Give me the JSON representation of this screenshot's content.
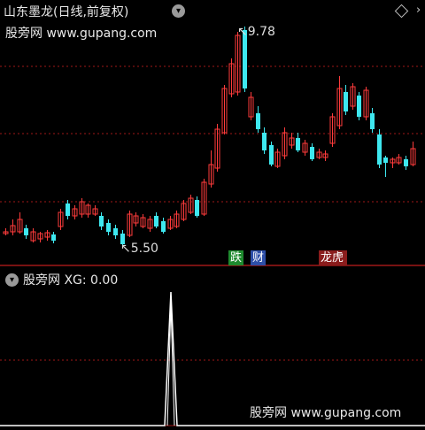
{
  "header": {
    "title": "山东墨龙(日线,前复权)",
    "dropdown_icon": "chevron-down-icon",
    "diamond_icon": "diamond-icon",
    "right_icon": "chevron-right-icon"
  },
  "watermark": {
    "text": "股旁网 www.gupang.com"
  },
  "price_panel": {
    "high_marker": "9.78",
    "low_marker": "5.50",
    "badges": [
      {
        "text": "跌",
        "color": "#1e8a2e"
      },
      {
        "text": "财",
        "color": "#2e4fa8"
      },
      {
        "text": "龙虎榜",
        "color": "#8a1c1c"
      }
    ],
    "up_color": "#ff3b3b",
    "down_color": "#3ee8f0",
    "grid_color": "#a01818"
  },
  "indicator_panel": {
    "name": "股旁网",
    "readout": "XG: 0.00",
    "line_color": "#ffffff"
  }
}
